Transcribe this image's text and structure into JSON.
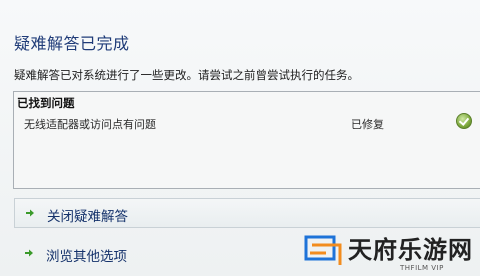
{
  "dialog": {
    "title": "疑难解答已完成",
    "description": "疑难解答已对系统进行了一些更改。请尝试之前曾尝试执行的任务。"
  },
  "problems": {
    "header": "已找到问题",
    "items": [
      {
        "name": "无线适配器或访问点有问题",
        "status": "已修复",
        "status_icon": "green-check-icon"
      }
    ]
  },
  "options": [
    {
      "label": "关闭疑难解答",
      "icon": "green-arrow-icon"
    },
    {
      "label": "浏览其他选项",
      "icon": "green-arrow-icon"
    }
  ],
  "watermark": {
    "text": "天府乐游网",
    "subtext": "THFILM VIP",
    "colors": {
      "blue": "#1e73d8",
      "orange": "#f28c1e"
    }
  },
  "colors": {
    "title": "#1f3b78",
    "link": "#15326b",
    "arrow": "#3a9a2a"
  }
}
